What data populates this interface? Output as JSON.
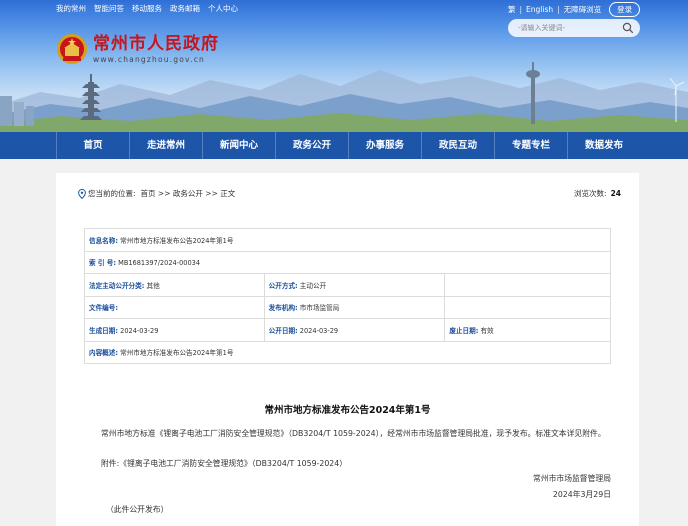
{
  "header": {
    "top_links": [
      "我的常州",
      "智能问答",
      "移动服务",
      "政务邮箱",
      "个人中心"
    ],
    "lang_trad": "繁",
    "lang_en": "English",
    "accessibility": "无障碍浏览",
    "login_label": "登录",
    "search_placeholder": "-请输入关键词-",
    "site_name": "常州市人民政府",
    "site_url": "www.changzhou.gov.cn",
    "colors": {
      "brand_red": "#c8151c",
      "nav_blue": "#1d56a9"
    }
  },
  "nav": {
    "items": [
      "首页",
      "走进常州",
      "新闻中心",
      "政务公开",
      "办事服务",
      "政民互动",
      "专题专栏",
      "数据发布"
    ]
  },
  "breadcrumb": {
    "prefix": "您当前的位置:",
    "path": "首页 >> 政务公开 >> 正文"
  },
  "views": {
    "label": "浏览次数:",
    "count": "24"
  },
  "meta": {
    "name_k": "信息名称:",
    "name_v": "常州市地方标准发布公告2024年第1号",
    "index_k": "索 引 号:",
    "index_v": "MB1681397/2024-00034",
    "category_k": "法定主动公开分类:",
    "category_v": "其他",
    "method_k": "公开方式:",
    "method_v": "主动公开",
    "docno_k": "文件编号:",
    "docno_v": "",
    "org_k": "发布机构:",
    "org_v": "市市场监管局",
    "created_k": "生成日期:",
    "created_v": "2024-03-29",
    "published_k": "公开日期:",
    "published_v": "2024-03-29",
    "expire_k": "废止日期:",
    "expire_v": "有效",
    "summary_k": "内容概述:",
    "summary_v": "常州市地方标准发布公告2024年第1号"
  },
  "article": {
    "title": "常州市地方标准发布公告2024年第1号",
    "p1": "常州市地方标准《锂离子电池工厂消防安全管理规范》（DB3204/T 1059-2024），经常州市市场监督管理局批准，现予发布。标准文本详见附件。",
    "p2": "附件:《锂离子电池工厂消防安全管理规范》（DB3204/T 1059-2024）",
    "sign_org": "常州市市场监督管理局",
    "sign_date": "2024年3月29日",
    "note": "（此件公开发布）"
  }
}
